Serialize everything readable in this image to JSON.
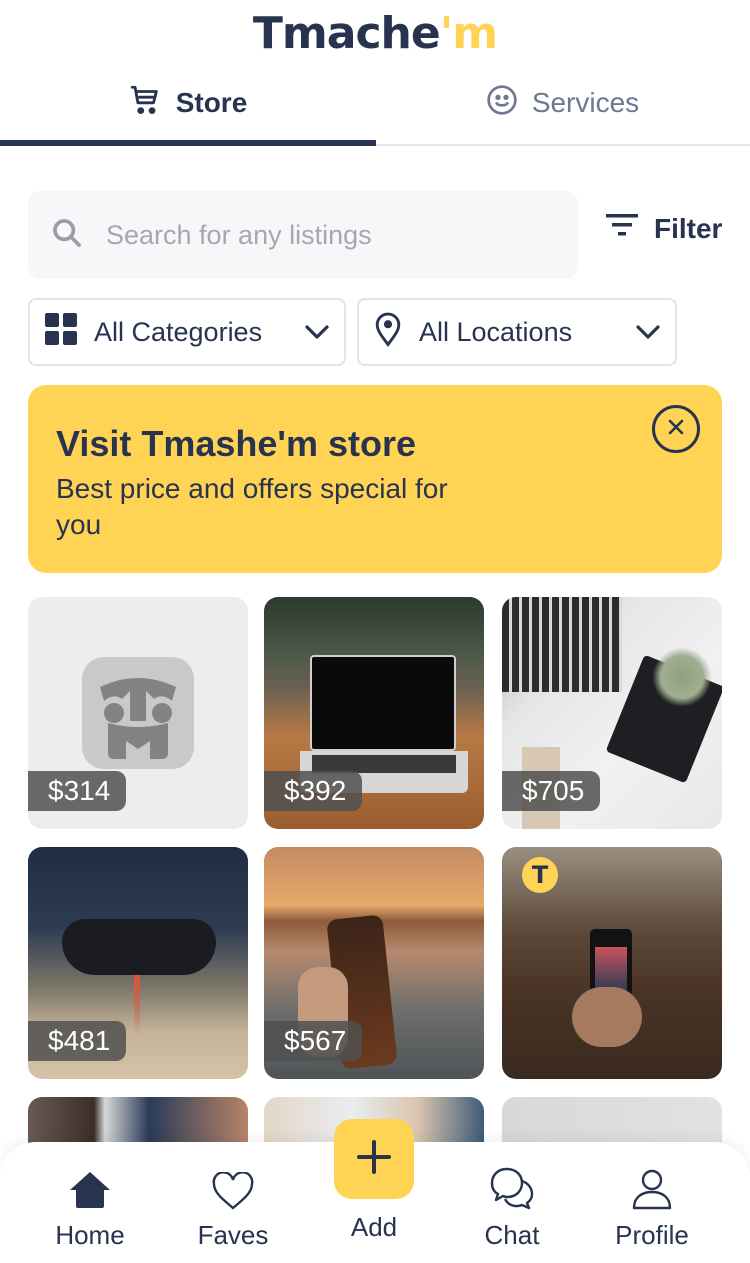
{
  "app": {
    "logo_main": "Tmache",
    "logo_accent": "'m",
    "brand_color": "#283350",
    "accent_color": "#FFD455"
  },
  "tabs": [
    {
      "label": "Store",
      "icon": "cart-icon",
      "active": true
    },
    {
      "label": "Services",
      "icon": "smiley-icon",
      "active": false
    }
  ],
  "search": {
    "placeholder": "Search for any listings",
    "value": ""
  },
  "filter": {
    "label": "Filter"
  },
  "dropdowns": {
    "category": {
      "selected": "All Categories",
      "icon": "grid-icon"
    },
    "location": {
      "selected": "All Locations",
      "icon": "location-pin-icon"
    }
  },
  "banner": {
    "title": "Visit Tmashe'm store",
    "subtitle": "Best price and offers special for you"
  },
  "listings": [
    {
      "price": "$314",
      "image": "placeholder-logo"
    },
    {
      "price": "$392",
      "image": "laptop-on-desk"
    },
    {
      "price": "$705",
      "image": "typing-on-laptop"
    },
    {
      "price": "$481",
      "image": "game-controller"
    },
    {
      "price": "$567",
      "image": "phone-at-sunset"
    },
    {
      "price": "",
      "image": "phone-in-forest",
      "badge": "T"
    },
    {
      "price": "",
      "image": "photo-wall"
    },
    {
      "price": "",
      "image": "desk-workspace"
    },
    {
      "price": "",
      "image": "white-room"
    }
  ],
  "bottom_nav": [
    {
      "label": "Home",
      "icon": "home-icon",
      "active": true
    },
    {
      "label": "Faves",
      "icon": "heart-icon"
    },
    {
      "label": "Add",
      "icon": "plus-icon"
    },
    {
      "label": "Chat",
      "icon": "chat-icon"
    },
    {
      "label": "Profile",
      "icon": "user-icon"
    }
  ]
}
